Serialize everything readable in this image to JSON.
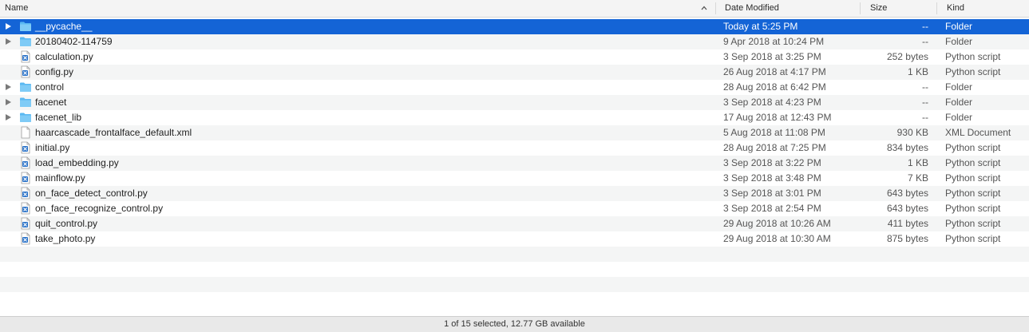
{
  "columns": {
    "name": "Name",
    "date_modified": "Date Modified",
    "size": "Size",
    "kind": "Kind"
  },
  "files": [
    {
      "name": "__pycache__",
      "date": "Today at 5:25 PM",
      "size": "--",
      "kind": "Folder",
      "type": "folder",
      "selected": true
    },
    {
      "name": "20180402-114759",
      "date": "9 Apr 2018 at 10:24 PM",
      "size": "--",
      "kind": "Folder",
      "type": "folder"
    },
    {
      "name": "calculation.py",
      "date": "3 Sep 2018 at 3:25 PM",
      "size": "252 bytes",
      "kind": "Python script",
      "type": "python"
    },
    {
      "name": "config.py",
      "date": "26 Aug 2018 at 4:17 PM",
      "size": "1 KB",
      "kind": "Python script",
      "type": "python"
    },
    {
      "name": "control",
      "date": "28 Aug 2018 at 6:42 PM",
      "size": "--",
      "kind": "Folder",
      "type": "folder"
    },
    {
      "name": "facenet",
      "date": "3 Sep 2018 at 4:23 PM",
      "size": "--",
      "kind": "Folder",
      "type": "folder"
    },
    {
      "name": "facenet_lib",
      "date": "17 Aug 2018 at 12:43 PM",
      "size": "--",
      "kind": "Folder",
      "type": "folder"
    },
    {
      "name": "haarcascade_frontalface_default.xml",
      "date": "5 Aug 2018 at 11:08 PM",
      "size": "930 KB",
      "kind": "XML Document",
      "type": "document"
    },
    {
      "name": "initial.py",
      "date": "28 Aug 2018 at 7:25 PM",
      "size": "834 bytes",
      "kind": "Python script",
      "type": "python"
    },
    {
      "name": "load_embedding.py",
      "date": "3 Sep 2018 at 3:22 PM",
      "size": "1 KB",
      "kind": "Python script",
      "type": "python"
    },
    {
      "name": "mainflow.py",
      "date": "3 Sep 2018 at 3:48 PM",
      "size": "7 KB",
      "kind": "Python script",
      "type": "python"
    },
    {
      "name": "on_face_detect_control.py",
      "date": "3 Sep 2018 at 3:01 PM",
      "size": "643 bytes",
      "kind": "Python script",
      "type": "python"
    },
    {
      "name": "on_face_recognize_control.py",
      "date": "3 Sep 2018 at 2:54 PM",
      "size": "643 bytes",
      "kind": "Python script",
      "type": "python"
    },
    {
      "name": "quit_control.py",
      "date": "29 Aug 2018 at 10:26 AM",
      "size": "411 bytes",
      "kind": "Python script",
      "type": "python"
    },
    {
      "name": "take_photo.py",
      "date": "29 Aug 2018 at 10:30 AM",
      "size": "875 bytes",
      "kind": "Python script",
      "type": "python"
    }
  ],
  "status_bar": {
    "text": "1 of 15 selected, 12.77 GB available"
  },
  "colors": {
    "selection": "#1464d6",
    "folder": "#5ab8f2",
    "python_icon": "#2a72c8"
  }
}
